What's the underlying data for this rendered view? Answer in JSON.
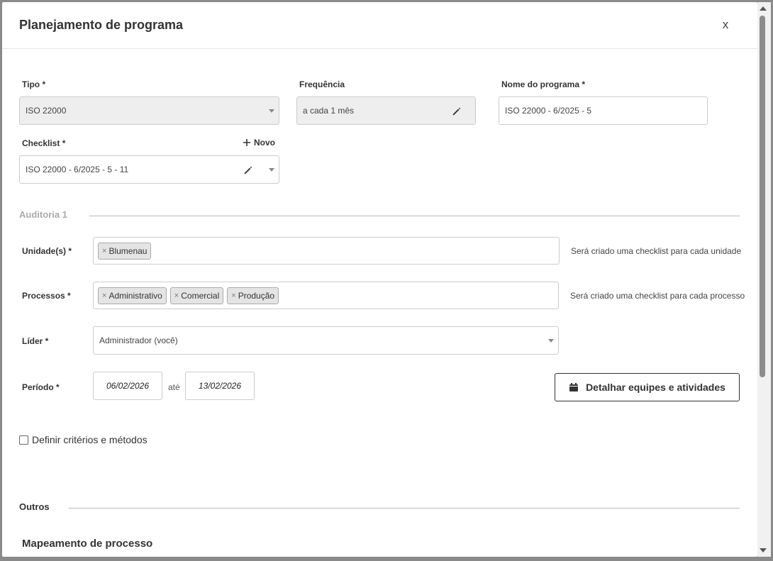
{
  "modal": {
    "title": "Planejamento de programa",
    "close_label": "x"
  },
  "form": {
    "tipo": {
      "label": "Tipo *",
      "value": "ISO 22000"
    },
    "frequencia": {
      "label": "Frequência",
      "value": "a cada 1 mês"
    },
    "nome_programa": {
      "label": "Nome do programa *",
      "value": "ISO 22000 - 6/2025 - 5"
    },
    "checklist": {
      "label": "Checklist *",
      "value": "ISO 22000 - 6/2025 - 5 - 11",
      "novo_label": "Novo"
    }
  },
  "auditoria": {
    "section_title": "Auditoria 1",
    "unidades": {
      "label": "Unidade(s) *",
      "tags": [
        "Blumenau"
      ],
      "hint": "Será criado uma checklist para cada unidade"
    },
    "processos": {
      "label": "Processos *",
      "tags": [
        "Administrativo",
        "Comercial",
        "Produção"
      ],
      "hint": "Será criado uma checklist para cada processo"
    },
    "lider": {
      "label": "Líder *",
      "value": "Administrador (você)"
    },
    "periodo": {
      "label": "Período *",
      "start": "06/02/2026",
      "separator": "até",
      "end": "13/02/2026"
    },
    "detalhar_button": "Detalhar equipes e atividades",
    "criterios_label": "Definir critérios e métodos"
  },
  "outros": {
    "section_title": "Outros",
    "subsection_title": "Mapeamento de processo"
  },
  "tag_remove_glyph": "×"
}
